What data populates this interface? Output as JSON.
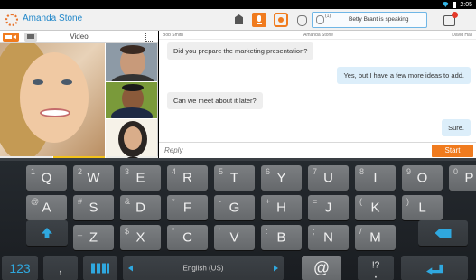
{
  "statusbar": {
    "time": "2:05"
  },
  "actionbar": {
    "user_name": "Amanda Stone",
    "speaking_count": "(1)",
    "speaking_text": "Betty Brant is speaking"
  },
  "video": {
    "title": "Video"
  },
  "chat": {
    "participants": [
      "Bob Smith",
      "Amanda Stone",
      "David Hall"
    ],
    "messages": [
      {
        "text": "Did you prepare the marketing presentation?",
        "side": "left"
      },
      {
        "text": "Yes, but I have a few more ideas to add.",
        "side": "right"
      },
      {
        "text": "Can we meet about it later?",
        "side": "left"
      },
      {
        "text": "Sure.",
        "side": "right"
      }
    ],
    "reply_placeholder": "Reply",
    "start_label": "Start"
  },
  "keyboard": {
    "row1": [
      {
        "main": "Q",
        "sub": "1"
      },
      {
        "main": "W",
        "sub": "2"
      },
      {
        "main": "E",
        "sub": "3"
      },
      {
        "main": "R",
        "sub": "4"
      },
      {
        "main": "T",
        "sub": "5"
      },
      {
        "main": "Y",
        "sub": "6"
      },
      {
        "main": "U",
        "sub": "7"
      },
      {
        "main": "I",
        "sub": "8"
      },
      {
        "main": "O",
        "sub": "9"
      },
      {
        "main": "P",
        "sub": "0"
      }
    ],
    "row2": [
      {
        "main": "A",
        "sub": "@"
      },
      {
        "main": "S",
        "sub": "#"
      },
      {
        "main": "D",
        "sub": "&"
      },
      {
        "main": "F",
        "sub": "*"
      },
      {
        "main": "G",
        "sub": "-"
      },
      {
        "main": "H",
        "sub": "+"
      },
      {
        "main": "J",
        "sub": "="
      },
      {
        "main": "K",
        "sub": "("
      },
      {
        "main": "L",
        "sub": ")"
      }
    ],
    "row3": [
      {
        "main": "Z",
        "sub": "_"
      },
      {
        "main": "X",
        "sub": "$"
      },
      {
        "main": "C",
        "sub": "\""
      },
      {
        "main": "V",
        "sub": "'"
      },
      {
        "main": "B",
        "sub": ":"
      },
      {
        "main": "N",
        "sub": ";"
      },
      {
        "main": "M",
        "sub": "/"
      }
    ],
    "num_label": "123",
    "comma": ",",
    "space_label": "English (US)",
    "at": "@",
    "punct": "!?",
    "period": "."
  }
}
